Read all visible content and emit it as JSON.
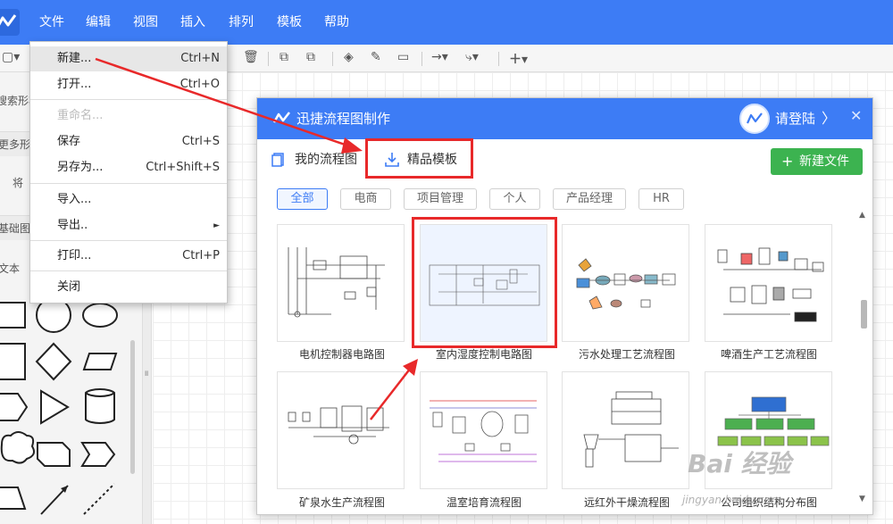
{
  "menubar": {
    "items": [
      "文件",
      "编辑",
      "视图",
      "插入",
      "排列",
      "模板",
      "帮助"
    ]
  },
  "left_panel": {
    "search_placeholder": "搜索形状",
    "more_shapes": "更多形状",
    "drag_hint": "将",
    "basic_shapes": "基础图形",
    "text_shape": "文本"
  },
  "file_menu": {
    "items": [
      {
        "label": "新建...",
        "shortcut": "Ctrl+N",
        "highlighted": true
      },
      {
        "label": "打开...",
        "shortcut": "Ctrl+O"
      },
      {
        "label": "重命名...",
        "shortcut": "",
        "disabled": true
      },
      {
        "label": "保存",
        "shortcut": "Ctrl+S"
      },
      {
        "label": "另存为...",
        "shortcut": "Ctrl+Shift+S"
      },
      {
        "label": "导入...",
        "shortcut": ""
      },
      {
        "label": "导出..",
        "shortcut": "►"
      },
      {
        "label": "打印...",
        "shortcut": "Ctrl+P"
      },
      {
        "label": "关闭",
        "shortcut": ""
      }
    ]
  },
  "dialog": {
    "title": "迅捷流程图制作",
    "login": "请登陆",
    "login_arrow": "〉",
    "close": "✕",
    "tab_mine": "我的流程图",
    "tab_templates": "精品模板",
    "new_file": "新建文件",
    "new_file_icon": "+",
    "filters": [
      "全部",
      "电商",
      "项目管理",
      "个人",
      "产品经理",
      "HR"
    ],
    "active_filter": "全部",
    "templates": [
      "电机控制器电路图",
      "室内湿度控制电路图",
      "污水处理工艺流程图",
      "啤酒生产工艺流程图",
      "矿泉水生产流程图",
      "温室培育流程图",
      "远红外干燥流程图",
      "公司组织结构分布图"
    ]
  },
  "watermark": {
    "text": "Bai 经验",
    "sub": "jingyan.baidu.com"
  },
  "colors": {
    "brand_blue": "#3d7cf5",
    "green_button": "#3cb350",
    "highlight_red": "#e8292a"
  }
}
